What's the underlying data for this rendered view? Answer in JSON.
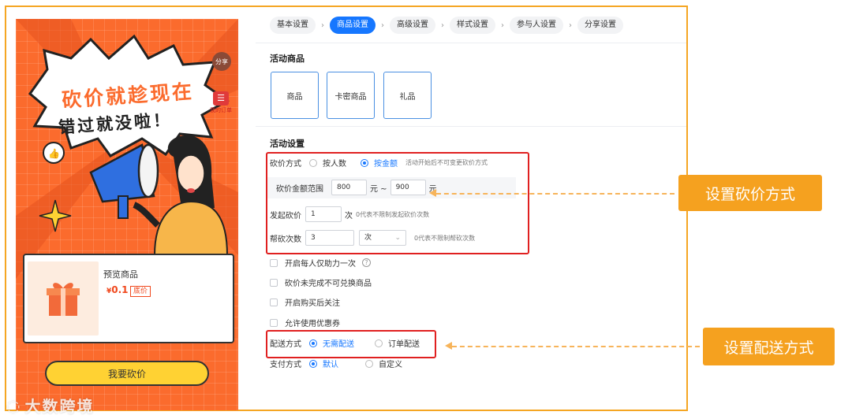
{
  "preview": {
    "share_label": "分享",
    "order_label": "我的订单",
    "headline": "砍价就趁现在",
    "subline": "错过就没啦！",
    "product": {
      "name": "预览商品",
      "currency": "¥",
      "price": "0.1",
      "price_tag": "底价"
    },
    "bargain_button": "我要砍价"
  },
  "watermark": "大数跨境",
  "steps": [
    "基本设置",
    "商品设置",
    "高级设置",
    "样式设置",
    "参与人设置",
    "分享设置"
  ],
  "active_step_index": 1,
  "goods_section": {
    "title": "活动商品",
    "types": [
      "商品",
      "卡密商品",
      "礼品"
    ]
  },
  "activity_section": {
    "title": "活动设置",
    "bargain_mode": {
      "label": "砍价方式",
      "options": [
        "按人数",
        "按金额"
      ],
      "selected": "按金额",
      "hint": "活动开始后不可变更砍价方式"
    },
    "amount_range": {
      "label": "砍价金额范围",
      "min": "800",
      "min_unit": "元 ~",
      "max": "900",
      "max_unit": "元"
    },
    "initiate": {
      "label": "发起砍价",
      "value": "1",
      "unit": "次",
      "hint": "0代表不限制发起砍价次数"
    },
    "help": {
      "label": "帮砍次数",
      "value": "3",
      "unit": "次",
      "hint": "0代表不限制帮砍次数"
    },
    "checkboxes": [
      "开启每人仅助力一次",
      "砍价未完成不可兑换商品",
      "开启购买后关注",
      "允许使用优惠券"
    ],
    "delivery": {
      "label": "配送方式",
      "options": [
        "无需配送",
        "订单配送"
      ],
      "selected": "无需配送"
    },
    "payment": {
      "label": "支付方式",
      "options": [
        "默认",
        "自定义"
      ],
      "selected": "默认"
    }
  },
  "annotations": {
    "bargain_mode_callout": "设置砍价方式",
    "delivery_callout": "设置配送方式"
  },
  "colors": {
    "accent": "#1677ff",
    "highlight_red": "#e02020",
    "callout_orange": "#f5a11f",
    "preview_orange": "#fb6b2d"
  }
}
